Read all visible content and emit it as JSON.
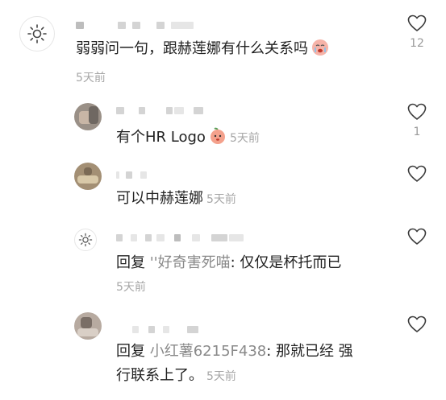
{
  "comments": [
    {
      "body": "弱弱问一句，跟赫莲娜有什么关系吗",
      "time": "5天前",
      "likes": "12",
      "avatar_icon": "sun-icon"
    },
    {
      "body": "有个HR Logo",
      "time": "5天前",
      "likes": "1",
      "avatar_icon": "photo-avatar"
    },
    {
      "body": "可以中赫莲娜",
      "time": "5天前",
      "likes": "",
      "avatar_icon": "photo-avatar"
    },
    {
      "reply_label": "回复",
      "reply_target": "''好奇害死喵",
      "body": ": 仅仅是杯托而已",
      "time": "5天前",
      "likes": "",
      "avatar_icon": "sun-icon"
    },
    {
      "reply_label": "回复",
      "reply_target": "小红薯6215F438",
      "body_line1": ": 那就已经 强",
      "body_line2": "行联系上了。",
      "time": "5天前",
      "likes": "",
      "avatar_icon": "photo-avatar"
    }
  ],
  "colors": {
    "text": "#222222",
    "muted": "#a6a6a6",
    "reply_target": "#8a8a8a",
    "heart_outline": "#3a3a3a"
  }
}
